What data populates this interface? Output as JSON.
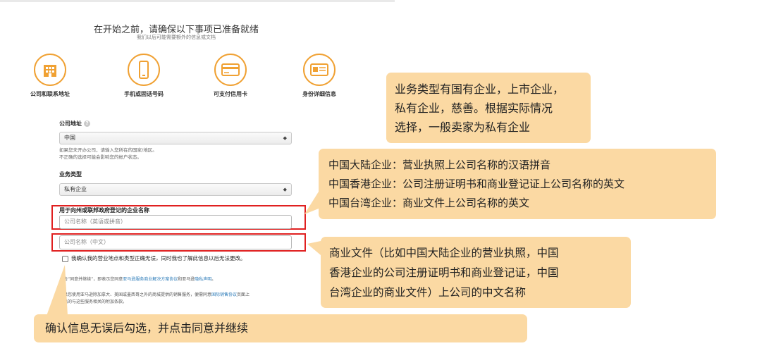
{
  "header": {
    "title": "在开始之前，请确保以下事项已准备就绪",
    "subtitle": "我们以后可能需要额外的信息或文档"
  },
  "requirements": [
    {
      "label": "公司和联系地址",
      "icon": "building-icon"
    },
    {
      "label": "手机或固话号码",
      "icon": "phone-icon"
    },
    {
      "label": "可支付信用卡",
      "icon": "credit-card-icon"
    },
    {
      "label": "身份详细信息",
      "icon": "id-card-icon"
    }
  ],
  "form": {
    "address_label": "公司地址",
    "address_value": "中国",
    "address_note_1": "如果您未开办公司，请输入您所在的国家/地区。",
    "address_note_2": "不正确的选择可能会影响您的帐户状态。",
    "biz_type_label": "业务类型",
    "biz_type_value": "私有企业",
    "company_name_label": "用于向州或联邦政府登记的企业名称",
    "name_en_placeholder": "公司名称（英语或拼音）",
    "name_cn_placeholder": "公司名称（中文）",
    "confirm_text": "我确认我的营业地点和类型正确无误，同时我也了解此信息以后无法更改。",
    "agree_prefix": "点击“同意并继续”，即表示您同意",
    "agree_link1": "亚马逊服务商业解决方案协议",
    "agree_mid": "和亚马逊",
    "agree_link2": "隐私声明",
    "agree_end": "。",
    "intl_line1_a": "如果您使用亚马逊除加拿大、美国或墨西哥之外的商城提供的销售服务，便需同意",
    "intl_link": "国际销售协议",
    "intl_line1_b": "页面上",
    "intl_line2": "列出的与这些服务相关的附加条款。"
  },
  "callouts": {
    "biz_type": [
      "业务类型有国有企业，上市企业，",
      "私有企业，慈善。根据实际情况",
      "选择，一般卖家为私有企业"
    ],
    "english_name": [
      "中国大陆企业：营业执照上公司名称的汉语拼音",
      "中国香港企业：公司注册证明书和商业登记证上公司名称的英文",
      "中国台湾企业：商业文件上公司名称的英文"
    ],
    "chinese_name": [
      "商业文件（比如中国大陆企业的营业执照，中国",
      "香港企业的公司注册证明书和商业登记证，中国",
      "台湾企业的商业文件）上公司的中文名称"
    ],
    "confirm": [
      "确认信息无误后勾选，并点击同意并继续"
    ]
  },
  "colors": {
    "icon_accent": "#f0a133",
    "callout_bg": "#fbd9a3",
    "highlight_border": "#e02020",
    "link": "#2a7ab8"
  }
}
